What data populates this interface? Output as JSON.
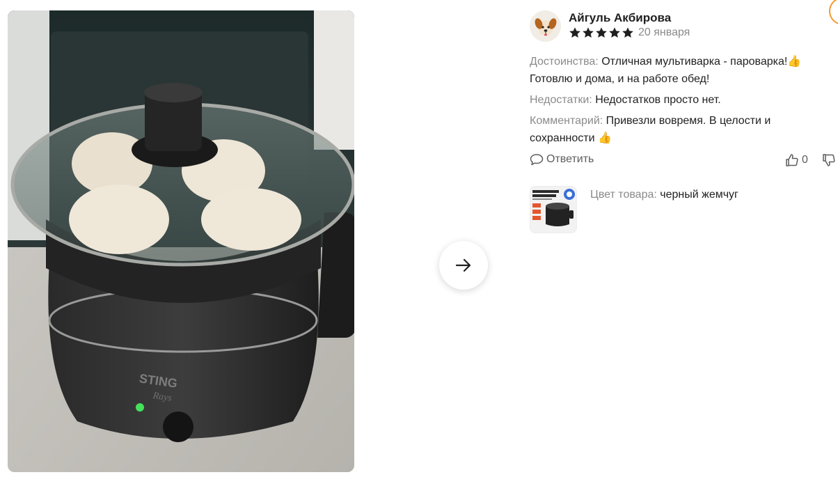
{
  "review": {
    "author": "Айгуль Акбирова",
    "rating": 5,
    "rating_max": 5,
    "date": "20 января",
    "pros_label": "Достоинства:",
    "pros_text": "Отличная мультиварка - пароварка!👍 Готовлю и дома, и на работе обед!",
    "cons_label": "Недостатки:",
    "cons_text": "Недостатков просто нет.",
    "comment_label": "Комментарий:",
    "comment_text": "Привезли вовремя. В целости и сохранности 👍",
    "reply_label": "Ответить",
    "likes": "0",
    "variant_label": "Цвет товара:",
    "variant_value": "черный жемчуг"
  },
  "gallery": {
    "photo_brand_text": "STING",
    "photo_brand_sub": "Rays"
  },
  "colors": {
    "star": "#1f1f1f",
    "muted": "#8a8a8a",
    "accent_ring": "#f29a2e"
  },
  "icons": {
    "next": "arrow-right-icon",
    "reply": "chat-bubble-icon",
    "like": "thumbs-up-icon",
    "dislike": "thumbs-down-icon",
    "avatar": "dog-avatar-icon"
  }
}
